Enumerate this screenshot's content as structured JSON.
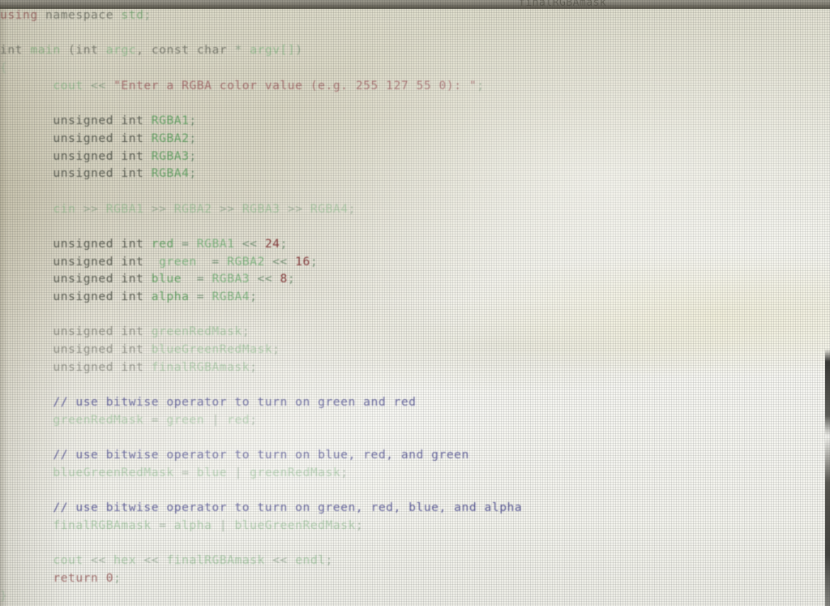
{
  "photo": {
    "subject": "monitor-photo-of-cpp-source-code",
    "top_partial_line": "finalRGBAmask"
  },
  "editor": {
    "language": "C++",
    "colors": {
      "background": "#f3f3ec",
      "keyword": "#8d4747",
      "identifier": "#6aa86a",
      "string": "#9a5055",
      "number": "#8c4040",
      "comment": "#5f5f9c",
      "plain": "#5f6257"
    }
  },
  "code": {
    "lines": [
      {
        "n": 1,
        "indent": 0,
        "tokens": [
          {
            "t": "using",
            "c": "kw"
          },
          {
            "t": " namespace ",
            "c": "pl"
          },
          {
            "t": "std",
            "c": "id"
          },
          {
            "t": ";",
            "c": "op"
          }
        ]
      },
      {
        "n": 2,
        "indent": 0,
        "tokens": []
      },
      {
        "n": 3,
        "indent": 0,
        "tokens": [
          {
            "t": "int ",
            "c": "pl"
          },
          {
            "t": "main",
            "c": "fn"
          },
          {
            "t": " (",
            "c": "pl"
          },
          {
            "t": "int ",
            "c": "pl"
          },
          {
            "t": "argc",
            "c": "idf"
          },
          {
            "t": ", ",
            "c": "pl"
          },
          {
            "t": "const char ",
            "c": "pl"
          },
          {
            "t": "*",
            "c": "op"
          },
          {
            "t": " argv[]",
            "c": "idf"
          },
          {
            "t": ")",
            "c": "op"
          }
        ]
      },
      {
        "n": 4,
        "indent": 0,
        "tokens": [
          {
            "t": "{",
            "c": "brc"
          }
        ]
      },
      {
        "n": 5,
        "indent": 4,
        "tokens": [
          {
            "t": "cout",
            "c": "idf"
          },
          {
            "t": " << ",
            "c": "op"
          },
          {
            "t": "\"Enter a RGBA color value (e.g. 255 127 55 0): \"",
            "c": "str"
          },
          {
            "t": ";",
            "c": "op"
          }
        ]
      },
      {
        "n": 6,
        "indent": 4,
        "tokens": []
      },
      {
        "n": 7,
        "indent": 4,
        "tokens": [
          {
            "t": "unsigned int ",
            "c": "pl"
          },
          {
            "t": "RGBA1",
            "c": "id"
          },
          {
            "t": ";",
            "c": "op"
          }
        ]
      },
      {
        "n": 8,
        "indent": 4,
        "tokens": [
          {
            "t": "unsigned int ",
            "c": "pl"
          },
          {
            "t": "RGBA2",
            "c": "id"
          },
          {
            "t": ";",
            "c": "op"
          }
        ]
      },
      {
        "n": 9,
        "indent": 4,
        "tokens": [
          {
            "t": "unsigned int ",
            "c": "pl"
          },
          {
            "t": "RGBA3",
            "c": "id"
          },
          {
            "t": ";",
            "c": "op"
          }
        ]
      },
      {
        "n": 10,
        "indent": 4,
        "tokens": [
          {
            "t": "unsigned int ",
            "c": "pl"
          },
          {
            "t": "RGBA4",
            "c": "id"
          },
          {
            "t": ";",
            "c": "op"
          }
        ]
      },
      {
        "n": 11,
        "indent": 4,
        "tokens": []
      },
      {
        "n": 12,
        "indent": 4,
        "tokens": [
          {
            "t": "cin",
            "c": "idf"
          },
          {
            "t": " >> ",
            "c": "op"
          },
          {
            "t": "RGBA1",
            "c": "idf"
          },
          {
            "t": " >> ",
            "c": "op"
          },
          {
            "t": "RGBA2",
            "c": "idf"
          },
          {
            "t": " >> ",
            "c": "op"
          },
          {
            "t": "RGBA3",
            "c": "idf"
          },
          {
            "t": " >> ",
            "c": "op"
          },
          {
            "t": "RGBA4",
            "c": "idf"
          },
          {
            "t": ";",
            "c": "op"
          }
        ]
      },
      {
        "n": 13,
        "indent": 4,
        "tokens": []
      },
      {
        "n": 14,
        "indent": 4,
        "tokens": [
          {
            "t": "unsigned int ",
            "c": "pl"
          },
          {
            "t": "red",
            "c": "id"
          },
          {
            "t": " = ",
            "c": "op"
          },
          {
            "t": "RGBA1",
            "c": "idf"
          },
          {
            "t": " << ",
            "c": "op"
          },
          {
            "t": "24",
            "c": "num"
          },
          {
            "t": ";",
            "c": "op"
          }
        ]
      },
      {
        "n": 15,
        "indent": 4,
        "tokens": [
          {
            "t": "unsigned int ",
            "c": "pl"
          },
          {
            "t": " green ",
            "c": "idf"
          },
          {
            "t": " = ",
            "c": "op"
          },
          {
            "t": "RGBA2",
            "c": "idf"
          },
          {
            "t": " << ",
            "c": "op"
          },
          {
            "t": "16",
            "c": "num"
          },
          {
            "t": ";",
            "c": "op"
          }
        ]
      },
      {
        "n": 16,
        "indent": 4,
        "tokens": [
          {
            "t": "unsigned int ",
            "c": "pl"
          },
          {
            "t": "blue",
            "c": "id"
          },
          {
            "t": "  = ",
            "c": "op"
          },
          {
            "t": "RGBA3",
            "c": "idf"
          },
          {
            "t": " << ",
            "c": "op"
          },
          {
            "t": "8",
            "c": "num"
          },
          {
            "t": ";",
            "c": "op"
          }
        ]
      },
      {
        "n": 17,
        "indent": 4,
        "tokens": [
          {
            "t": "unsigned int ",
            "c": "pl"
          },
          {
            "t": "alpha",
            "c": "id"
          },
          {
            "t": " = ",
            "c": "op"
          },
          {
            "t": "RGBA4",
            "c": "idf"
          },
          {
            "t": ";",
            "c": "op"
          }
        ]
      },
      {
        "n": 18,
        "indent": 4,
        "tokens": []
      },
      {
        "n": 19,
        "indent": 4,
        "tokens": [
          {
            "t": "unsigned int ",
            "c": "pl"
          },
          {
            "t": "greenRedMask",
            "c": "idf"
          },
          {
            "t": ";",
            "c": "op"
          }
        ]
      },
      {
        "n": 20,
        "indent": 4,
        "tokens": [
          {
            "t": "unsigned int ",
            "c": "pl"
          },
          {
            "t": "blueGreenRedMask",
            "c": "idf"
          },
          {
            "t": ";",
            "c": "op"
          }
        ]
      },
      {
        "n": 21,
        "indent": 4,
        "tokens": [
          {
            "t": "unsigned int ",
            "c": "pl"
          },
          {
            "t": "finalRGBAmask",
            "c": "idf"
          },
          {
            "t": ";",
            "c": "op"
          }
        ]
      },
      {
        "n": 22,
        "indent": 4,
        "tokens": []
      },
      {
        "n": 23,
        "indent": 4,
        "tokens": [
          {
            "t": "// use bitwise operator to turn on green and red",
            "c": "cmt"
          }
        ]
      },
      {
        "n": 24,
        "indent": 4,
        "tokens": [
          {
            "t": "greenRedMask",
            "c": "idf"
          },
          {
            "t": " = ",
            "c": "op"
          },
          {
            "t": "green",
            "c": "idf"
          },
          {
            "t": " | ",
            "c": "op"
          },
          {
            "t": "red",
            "c": "idf"
          },
          {
            "t": ";",
            "c": "op"
          }
        ]
      },
      {
        "n": 25,
        "indent": 4,
        "tokens": []
      },
      {
        "n": 26,
        "indent": 4,
        "tokens": [
          {
            "t": "// use bitwise operator to turn on blue, red, and green",
            "c": "cmt"
          }
        ]
      },
      {
        "n": 27,
        "indent": 4,
        "tokens": [
          {
            "t": "blueGreenRedMask",
            "c": "idf"
          },
          {
            "t": " = ",
            "c": "op"
          },
          {
            "t": "blue",
            "c": "idf"
          },
          {
            "t": " | ",
            "c": "op"
          },
          {
            "t": "greenRedMask",
            "c": "idf"
          },
          {
            "t": ";",
            "c": "op"
          }
        ]
      },
      {
        "n": 28,
        "indent": 4,
        "tokens": []
      },
      {
        "n": 29,
        "indent": 4,
        "tokens": [
          {
            "t": "// use bitwise operator to turn on green, red, blue, and alpha",
            "c": "cmt"
          }
        ]
      },
      {
        "n": 30,
        "indent": 4,
        "tokens": [
          {
            "t": "finalRGBAmask",
            "c": "idf"
          },
          {
            "t": " = ",
            "c": "op"
          },
          {
            "t": "alpha",
            "c": "idf"
          },
          {
            "t": " | ",
            "c": "op"
          },
          {
            "t": "blueGreenRedMask",
            "c": "idf"
          },
          {
            "t": ";",
            "c": "op"
          }
        ]
      },
      {
        "n": 31,
        "indent": 4,
        "tokens": []
      },
      {
        "n": 32,
        "indent": 4,
        "tokens": [
          {
            "t": "cout",
            "c": "idf"
          },
          {
            "t": " << ",
            "c": "op"
          },
          {
            "t": "hex",
            "c": "idf"
          },
          {
            "t": " << ",
            "c": "op"
          },
          {
            "t": "finalRGBAmask",
            "c": "idf"
          },
          {
            "t": " << ",
            "c": "op"
          },
          {
            "t": "endl",
            "c": "idf"
          },
          {
            "t": ";",
            "c": "op"
          }
        ]
      },
      {
        "n": 33,
        "indent": 4,
        "tokens": [
          {
            "t": "return",
            "c": "kw"
          },
          {
            "t": " ",
            "c": "pl"
          },
          {
            "t": "0",
            "c": "num"
          },
          {
            "t": ";",
            "c": "op"
          }
        ]
      },
      {
        "n": 34,
        "indent": 0,
        "tokens": [
          {
            "t": "}",
            "c": "brc"
          }
        ]
      }
    ]
  }
}
